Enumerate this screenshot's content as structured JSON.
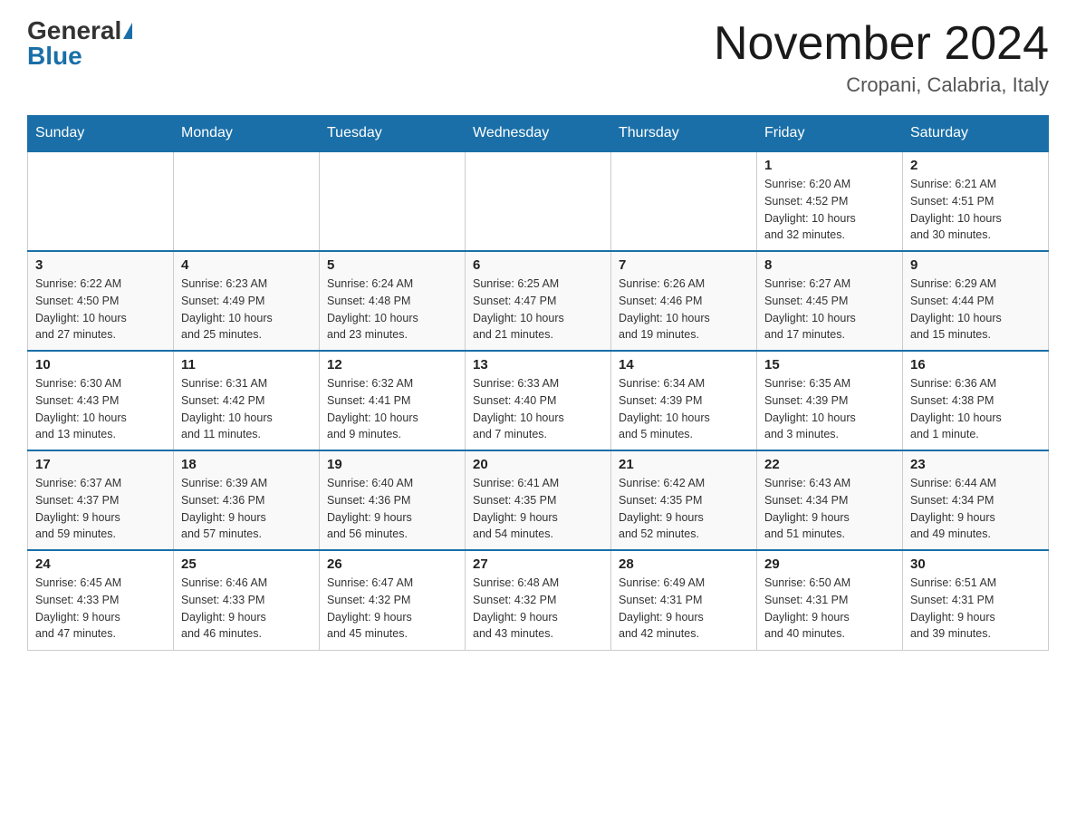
{
  "header": {
    "logo_general": "General",
    "logo_blue": "Blue",
    "month_title": "November 2024",
    "location": "Cropani, Calabria, Italy"
  },
  "days_of_week": [
    "Sunday",
    "Monday",
    "Tuesday",
    "Wednesday",
    "Thursday",
    "Friday",
    "Saturday"
  ],
  "weeks": [
    [
      {
        "day": "",
        "info": ""
      },
      {
        "day": "",
        "info": ""
      },
      {
        "day": "",
        "info": ""
      },
      {
        "day": "",
        "info": ""
      },
      {
        "day": "",
        "info": ""
      },
      {
        "day": "1",
        "info": "Sunrise: 6:20 AM\nSunset: 4:52 PM\nDaylight: 10 hours\nand 32 minutes."
      },
      {
        "day": "2",
        "info": "Sunrise: 6:21 AM\nSunset: 4:51 PM\nDaylight: 10 hours\nand 30 minutes."
      }
    ],
    [
      {
        "day": "3",
        "info": "Sunrise: 6:22 AM\nSunset: 4:50 PM\nDaylight: 10 hours\nand 27 minutes."
      },
      {
        "day": "4",
        "info": "Sunrise: 6:23 AM\nSunset: 4:49 PM\nDaylight: 10 hours\nand 25 minutes."
      },
      {
        "day": "5",
        "info": "Sunrise: 6:24 AM\nSunset: 4:48 PM\nDaylight: 10 hours\nand 23 minutes."
      },
      {
        "day": "6",
        "info": "Sunrise: 6:25 AM\nSunset: 4:47 PM\nDaylight: 10 hours\nand 21 minutes."
      },
      {
        "day": "7",
        "info": "Sunrise: 6:26 AM\nSunset: 4:46 PM\nDaylight: 10 hours\nand 19 minutes."
      },
      {
        "day": "8",
        "info": "Sunrise: 6:27 AM\nSunset: 4:45 PM\nDaylight: 10 hours\nand 17 minutes."
      },
      {
        "day": "9",
        "info": "Sunrise: 6:29 AM\nSunset: 4:44 PM\nDaylight: 10 hours\nand 15 minutes."
      }
    ],
    [
      {
        "day": "10",
        "info": "Sunrise: 6:30 AM\nSunset: 4:43 PM\nDaylight: 10 hours\nand 13 minutes."
      },
      {
        "day": "11",
        "info": "Sunrise: 6:31 AM\nSunset: 4:42 PM\nDaylight: 10 hours\nand 11 minutes."
      },
      {
        "day": "12",
        "info": "Sunrise: 6:32 AM\nSunset: 4:41 PM\nDaylight: 10 hours\nand 9 minutes."
      },
      {
        "day": "13",
        "info": "Sunrise: 6:33 AM\nSunset: 4:40 PM\nDaylight: 10 hours\nand 7 minutes."
      },
      {
        "day": "14",
        "info": "Sunrise: 6:34 AM\nSunset: 4:39 PM\nDaylight: 10 hours\nand 5 minutes."
      },
      {
        "day": "15",
        "info": "Sunrise: 6:35 AM\nSunset: 4:39 PM\nDaylight: 10 hours\nand 3 minutes."
      },
      {
        "day": "16",
        "info": "Sunrise: 6:36 AM\nSunset: 4:38 PM\nDaylight: 10 hours\nand 1 minute."
      }
    ],
    [
      {
        "day": "17",
        "info": "Sunrise: 6:37 AM\nSunset: 4:37 PM\nDaylight: 9 hours\nand 59 minutes."
      },
      {
        "day": "18",
        "info": "Sunrise: 6:39 AM\nSunset: 4:36 PM\nDaylight: 9 hours\nand 57 minutes."
      },
      {
        "day": "19",
        "info": "Sunrise: 6:40 AM\nSunset: 4:36 PM\nDaylight: 9 hours\nand 56 minutes."
      },
      {
        "day": "20",
        "info": "Sunrise: 6:41 AM\nSunset: 4:35 PM\nDaylight: 9 hours\nand 54 minutes."
      },
      {
        "day": "21",
        "info": "Sunrise: 6:42 AM\nSunset: 4:35 PM\nDaylight: 9 hours\nand 52 minutes."
      },
      {
        "day": "22",
        "info": "Sunrise: 6:43 AM\nSunset: 4:34 PM\nDaylight: 9 hours\nand 51 minutes."
      },
      {
        "day": "23",
        "info": "Sunrise: 6:44 AM\nSunset: 4:34 PM\nDaylight: 9 hours\nand 49 minutes."
      }
    ],
    [
      {
        "day": "24",
        "info": "Sunrise: 6:45 AM\nSunset: 4:33 PM\nDaylight: 9 hours\nand 47 minutes."
      },
      {
        "day": "25",
        "info": "Sunrise: 6:46 AM\nSunset: 4:33 PM\nDaylight: 9 hours\nand 46 minutes."
      },
      {
        "day": "26",
        "info": "Sunrise: 6:47 AM\nSunset: 4:32 PM\nDaylight: 9 hours\nand 45 minutes."
      },
      {
        "day": "27",
        "info": "Sunrise: 6:48 AM\nSunset: 4:32 PM\nDaylight: 9 hours\nand 43 minutes."
      },
      {
        "day": "28",
        "info": "Sunrise: 6:49 AM\nSunset: 4:31 PM\nDaylight: 9 hours\nand 42 minutes."
      },
      {
        "day": "29",
        "info": "Sunrise: 6:50 AM\nSunset: 4:31 PM\nDaylight: 9 hours\nand 40 minutes."
      },
      {
        "day": "30",
        "info": "Sunrise: 6:51 AM\nSunset: 4:31 PM\nDaylight: 9 hours\nand 39 minutes."
      }
    ]
  ]
}
